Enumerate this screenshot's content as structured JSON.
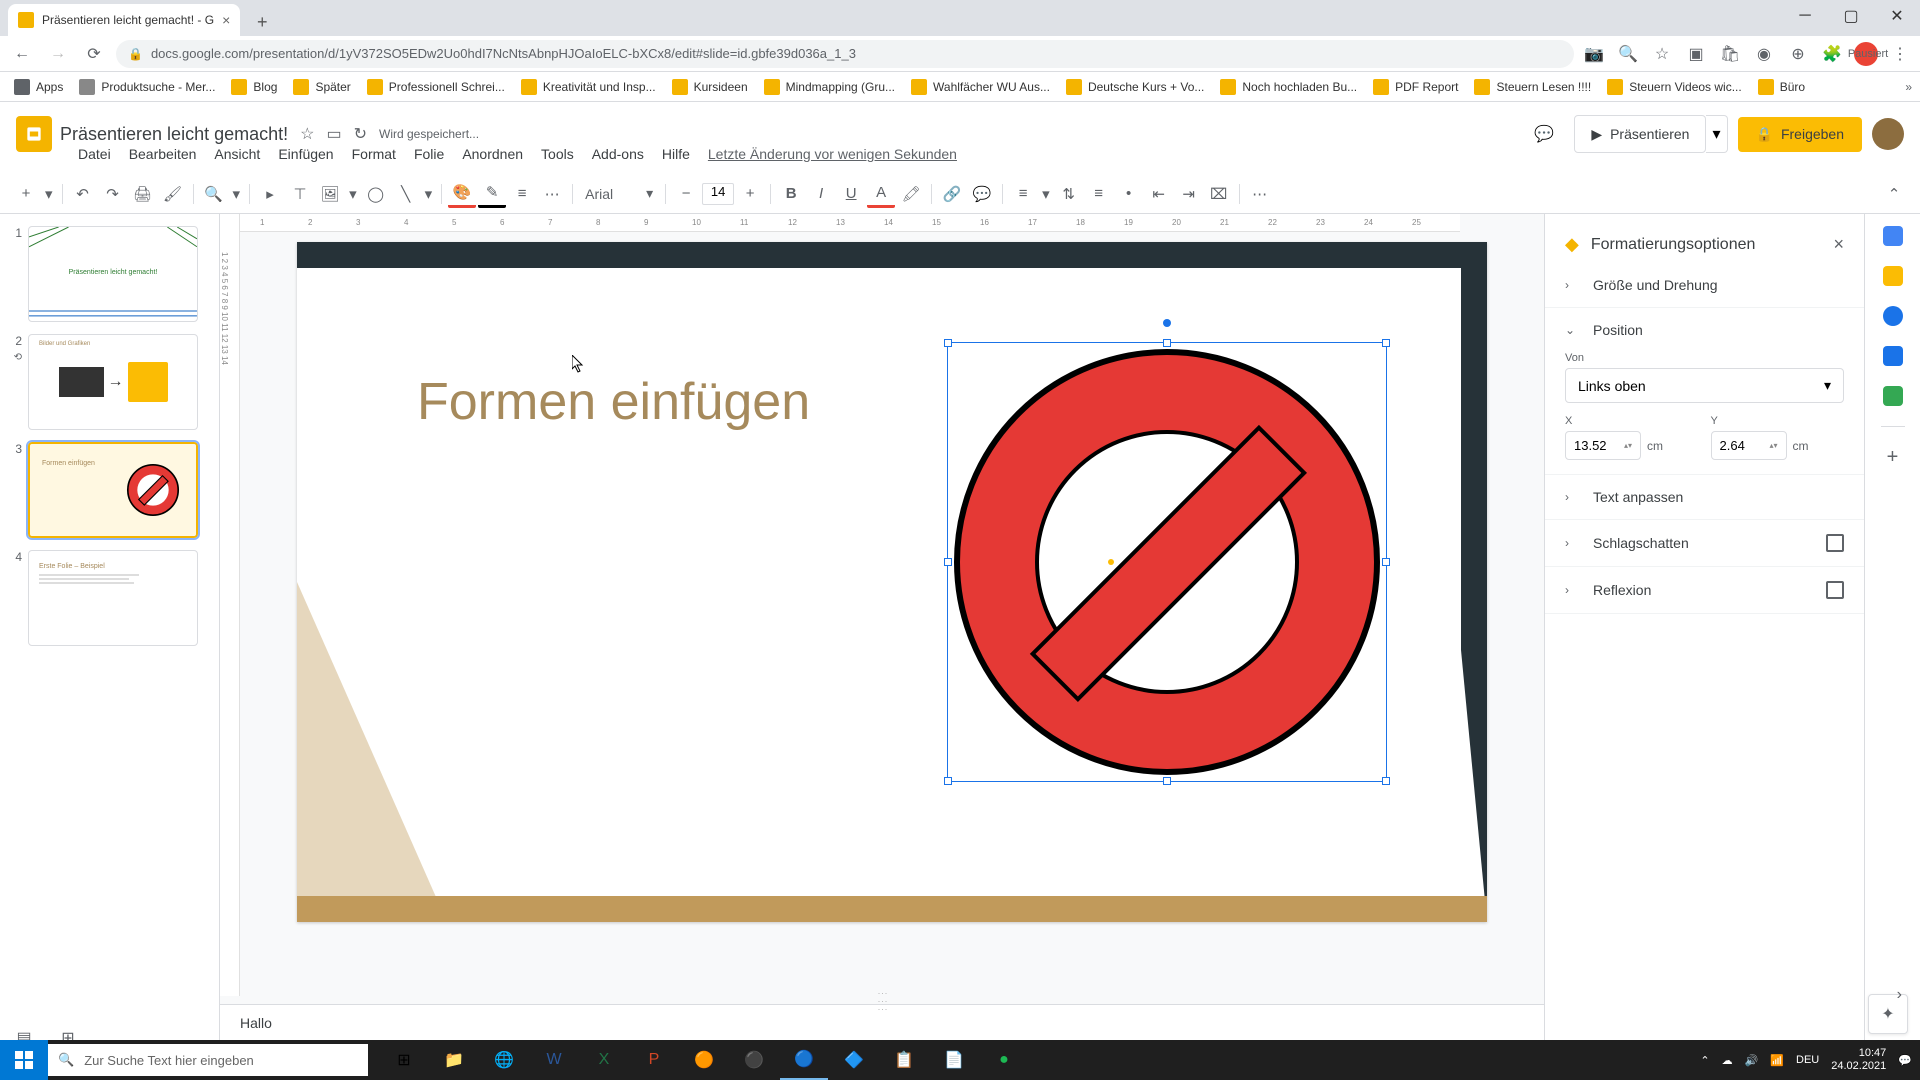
{
  "browser": {
    "tab_title": "Präsentieren leicht gemacht! - G",
    "url": "docs.google.com/presentation/d/1yV372SO5EDw2Uo0hdI7NcNtsAbnpHJOaIoELC-bXCx8/edit#slide=id.gbfe39d036a_1_3",
    "profile_status": "Pausiert"
  },
  "bookmarks": [
    "Apps",
    "Produktsuche - Mer...",
    "Blog",
    "Später",
    "Professionell Schrei...",
    "Kreativität und Insp...",
    "Kursideen",
    "Mindmapping (Gru...",
    "Wahlfächer WU Aus...",
    "Deutsche Kurs + Vo...",
    "Noch hochladen Bu...",
    "PDF Report",
    "Steuern Lesen !!!!",
    "Steuern Videos wic...",
    "Büro"
  ],
  "app": {
    "doc_title": "Präsentieren leicht gemacht!",
    "save_status": "Wird gespeichert...",
    "last_edit": "Letzte Änderung vor wenigen Sekunden",
    "present_label": "Präsentieren",
    "share_label": "Freigeben"
  },
  "menus": [
    "Datei",
    "Bearbeiten",
    "Ansicht",
    "Einfügen",
    "Format",
    "Folie",
    "Anordnen",
    "Tools",
    "Add-ons",
    "Hilfe"
  ],
  "toolbar": {
    "font": "Arial",
    "font_size": "14"
  },
  "slide": {
    "title": "Formen einfügen",
    "notes": "Hallo"
  },
  "thumbnails": {
    "t1_text": "Präsentieren leicht gemacht!",
    "t2_label": "Bilder und Grafiken",
    "t3_label": "Formen einfügen",
    "t4_label": "Erste Folie – Beispiel"
  },
  "format_panel": {
    "title": "Formatierungsoptionen",
    "sections": {
      "size_rotation": "Größe und Drehung",
      "position": "Position",
      "from_label": "Von",
      "from_value": "Links oben",
      "x_label": "X",
      "y_label": "Y",
      "x_value": "13.52",
      "y_value": "2.64",
      "unit": "cm",
      "text_fit": "Text anpassen",
      "drop_shadow": "Schlagschatten",
      "reflection": "Reflexion"
    }
  },
  "taskbar": {
    "search_placeholder": "Zur Suche Text hier eingeben",
    "lang": "DEU",
    "time": "10:47",
    "date": "24.02.2021"
  }
}
